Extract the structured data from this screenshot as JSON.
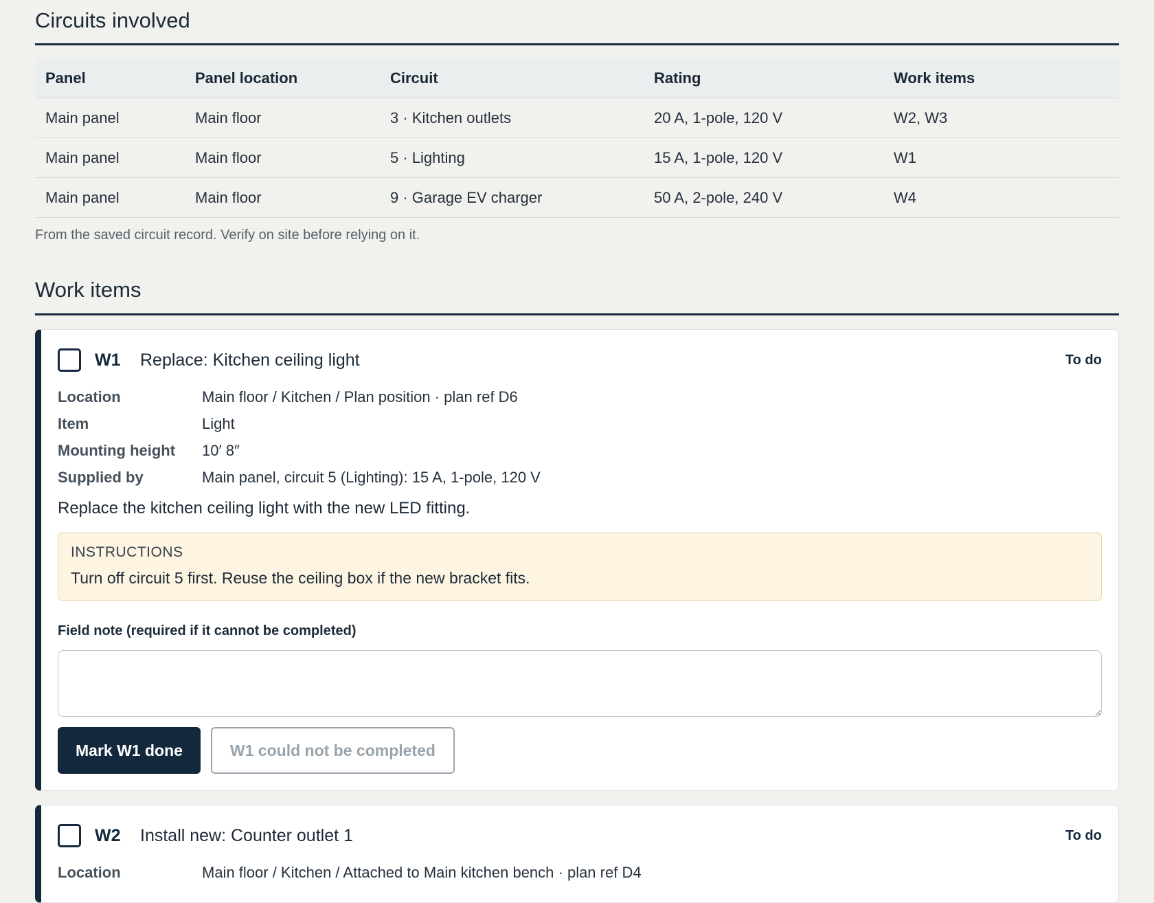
{
  "circuits_section": {
    "title": "Circuits involved",
    "columns": [
      "Panel",
      "Panel location",
      "Circuit",
      "Rating",
      "Work items"
    ],
    "rows": [
      [
        "Main panel",
        "Main floor",
        "3 · Kitchen outlets",
        "20 A, 1-pole, 120 V",
        "W2, W3"
      ],
      [
        "Main panel",
        "Main floor",
        "5 · Lighting",
        "15 A, 1-pole, 120 V",
        "W1"
      ],
      [
        "Main panel",
        "Main floor",
        "9 · Garage EV charger",
        "50 A, 2-pole, 240 V",
        "W4"
      ]
    ],
    "footnote": "From the saved circuit record. Verify on site before relying on it."
  },
  "work_section": {
    "title": "Work items",
    "items": [
      {
        "id": "W1",
        "title": "Replace: Kitchen ceiling light",
        "status": "To do",
        "details": [
          {
            "label": "Location",
            "value": "Main floor / Kitchen / Plan position · plan ref D6"
          },
          {
            "label": "Item",
            "value": "Light"
          },
          {
            "label": "Mounting height",
            "value": "10′ 8″"
          },
          {
            "label": "Supplied by",
            "value": "Main panel, circuit 5 (Lighting): 15 A, 1-pole, 120 V"
          }
        ],
        "description": "Replace the kitchen ceiling light with the new LED fitting.",
        "instructions_label": "INSTRUCTIONS",
        "instructions_text": "Turn off circuit 5 first. Reuse the ceiling box if the new bracket fits.",
        "field_note_label": "Field note (required if it cannot be completed)",
        "field_note_value": "",
        "done_button": "Mark W1 done",
        "fail_button": "W1 could not be completed"
      },
      {
        "id": "W2",
        "title": "Install new: Counter outlet 1",
        "status": "To do",
        "details": [
          {
            "label": "Location",
            "value": "Main floor / Kitchen / Attached to Main kitchen bench · plan ref D4"
          }
        ]
      }
    ]
  }
}
